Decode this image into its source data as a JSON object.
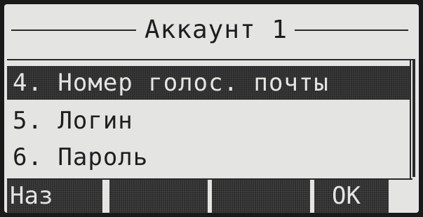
{
  "screen": {
    "title": "Аккаунт 1"
  },
  "menu": {
    "items": [
      {
        "label": "4. Номер голос. почты",
        "selected": true
      },
      {
        "label": "5. Логин",
        "selected": false
      },
      {
        "label": "6. Пароль",
        "selected": false
      }
    ]
  },
  "softkeys": [
    {
      "label": "Наз"
    },
    {
      "label": ""
    },
    {
      "label": ""
    },
    {
      "label": "OK"
    }
  ],
  "colors": {
    "lcd_background": "#e4e4e2",
    "lcd_foreground": "#1e1e1e",
    "highlight": "#2b2b2b"
  }
}
